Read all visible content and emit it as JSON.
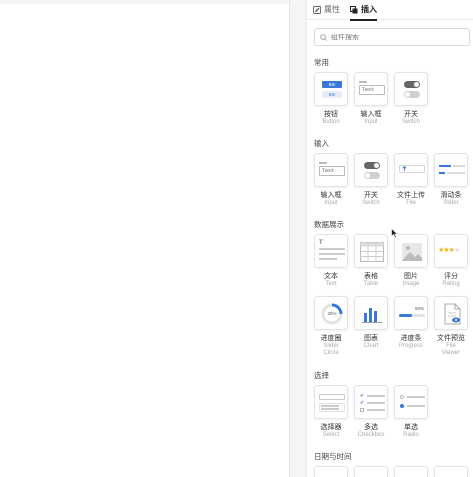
{
  "tabs": [
    {
      "label": "属性",
      "icon": "edit-icon"
    },
    {
      "label": "插入",
      "icon": "insert-icon"
    }
  ],
  "search": {
    "placeholder": "组件搜索"
  },
  "sections": {
    "common": {
      "title": "常用"
    },
    "input": {
      "title": "输入"
    },
    "display": {
      "title": "数据展示"
    },
    "select": {
      "title": "选择"
    },
    "datetime": {
      "title": "日期与时间"
    }
  },
  "items": {
    "button": {
      "label": "按钮",
      "sub": "Button"
    },
    "input_box": {
      "label": "输入框",
      "sub": "Input"
    },
    "switch": {
      "label": "开关",
      "sub": "Switch"
    },
    "input_box2": {
      "label": "输入框",
      "sub": "Input"
    },
    "switch2": {
      "label": "开关",
      "sub": "Switch"
    },
    "file_upload": {
      "label": "文件上传",
      "sub": "File"
    },
    "slider": {
      "label": "滑动条",
      "sub": "Slider"
    },
    "text": {
      "label": "文本",
      "sub": "Text"
    },
    "table": {
      "label": "表格",
      "sub": "Table"
    },
    "image": {
      "label": "图片",
      "sub": "Image"
    },
    "rating": {
      "label": "评分",
      "sub": "Rating"
    },
    "progress_circle": {
      "label": "进度圈",
      "sub1": "Slider",
      "sub2": "Circle"
    },
    "chart": {
      "label": "图表",
      "sub": "Chart"
    },
    "progress": {
      "label": "进度条",
      "sub": "Progress"
    },
    "file_viewer": {
      "label": "文件预览",
      "sub1": "File",
      "sub2": "Viewer"
    },
    "select": {
      "label": "选择器",
      "sub": "Select"
    },
    "checkbox": {
      "label": "多选",
      "sub": "Checkbox"
    },
    "radio": {
      "label": "单选",
      "sub": "Radio"
    }
  },
  "thumb_text": {
    "btn_top": "Btn",
    "btn_bottom": "Btn",
    "text_field": "Text",
    "progress_circle": "25%",
    "progress_bar": "50%"
  },
  "colors": {
    "accent": "#3a78d8",
    "star": "#f5b400",
    "text": "#333333",
    "muted": "#aaaaaa"
  }
}
